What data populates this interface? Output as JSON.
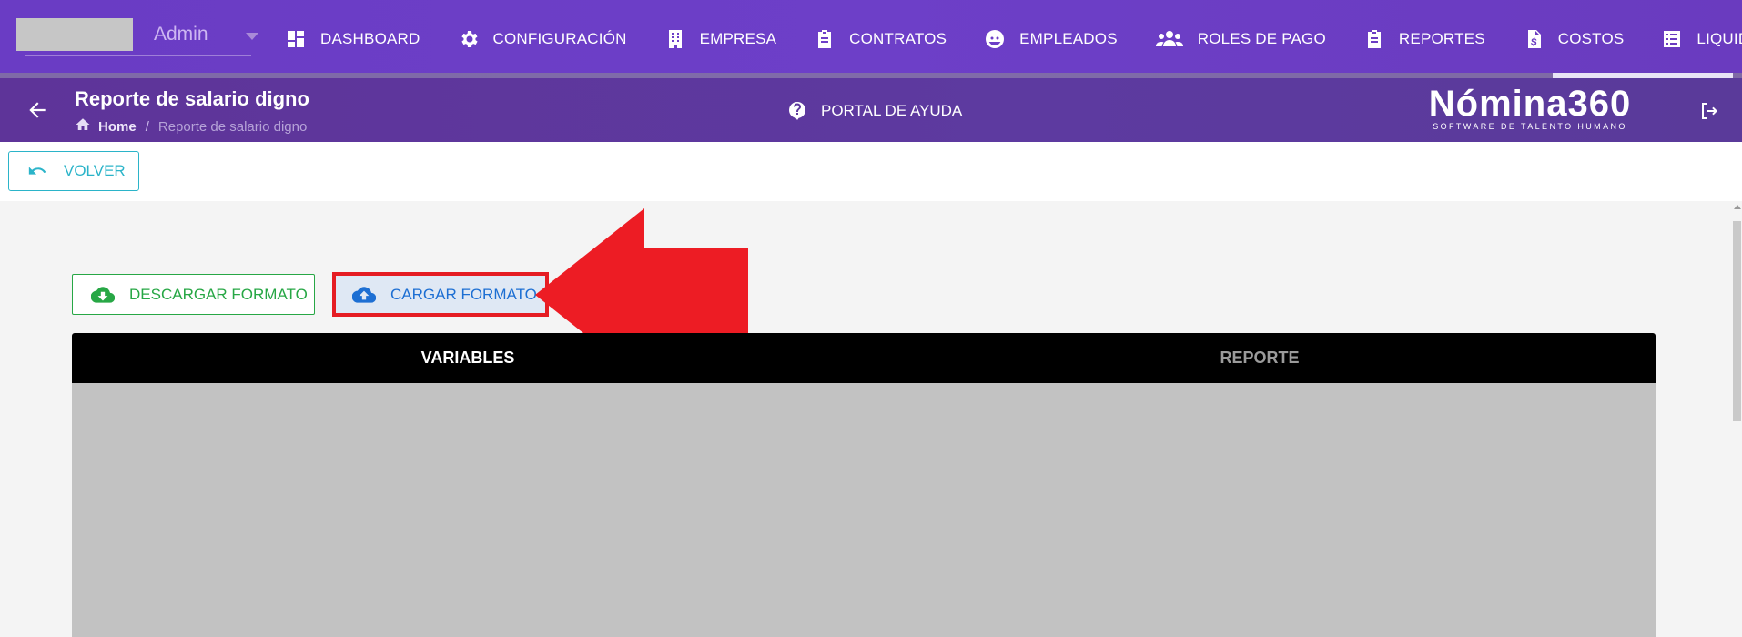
{
  "user": {
    "role": "Admin"
  },
  "nav": {
    "items": [
      {
        "label": "DASHBOARD",
        "icon": "dashboard-icon"
      },
      {
        "label": "CONFIGURACIÓN",
        "icon": "gear-icon"
      },
      {
        "label": "EMPRESA",
        "icon": "building-icon"
      },
      {
        "label": "CONTRATOS",
        "icon": "clipboard-icon"
      },
      {
        "label": "EMPLEADOS",
        "icon": "employee-face-icon"
      },
      {
        "label": "ROLES DE PAGO",
        "icon": "group-icon"
      },
      {
        "label": "REPORTES",
        "icon": "clipboard-icon"
      },
      {
        "label": "COSTOS",
        "icon": "dollar-file-icon"
      },
      {
        "label": "LIQUIDACIONES",
        "icon": "list-icon"
      }
    ]
  },
  "header": {
    "title": "Reporte de salario digno",
    "breadcrumb": {
      "home": "Home",
      "separator": "/",
      "current": "Reporte de salario digno"
    },
    "help": "PORTAL DE AYUDA",
    "brand": {
      "name": "Nómina360",
      "tagline": "SOFTWARE DE TALENTO HUMANO"
    }
  },
  "toolbar": {
    "back_label": "VOLVER"
  },
  "actions": {
    "download_label": "DESCARGAR FORMATO",
    "upload_label": "CARGAR FORMATO"
  },
  "tabs": [
    {
      "label": "VARIABLES",
      "active": true
    },
    {
      "label": "REPORTE",
      "active": false
    }
  ],
  "colors": {
    "nav_bg": "#6a3cc4",
    "subheader_bg": "#5e3499",
    "teal": "#2bb4c9",
    "green": "#27a745",
    "blue": "#1d6fd3",
    "annotation_red": "#e51c23"
  }
}
